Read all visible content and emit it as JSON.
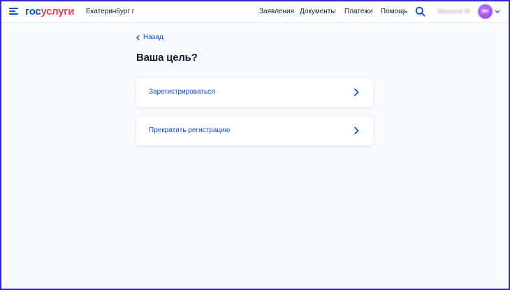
{
  "header": {
    "logo_part1": "гос",
    "logo_part2": "услуги",
    "city": "Екатеринбург г",
    "nav": [
      "Заявления",
      "Документы",
      "Платежи",
      "Помощь"
    ],
    "user_name": "Мальков М.",
    "avatar_initials": "МН"
  },
  "page": {
    "back_label": "Назад",
    "title": "Ваша цель?",
    "options": [
      "Зарегистрироваться",
      "Прекратить регистрацию"
    ]
  },
  "colors": {
    "accent": "#0d4cd3",
    "brand_red": "#ee3f58",
    "text": "#0b1f33",
    "frame": "#2f27d6"
  }
}
